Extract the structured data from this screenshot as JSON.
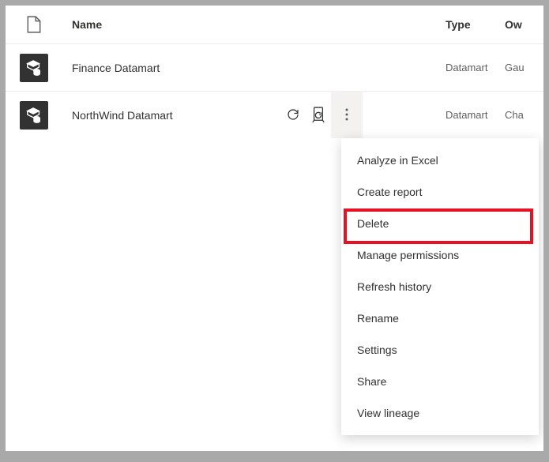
{
  "columns": {
    "name": "Name",
    "type": "Type",
    "owner": "Ow"
  },
  "rows": [
    {
      "name": "Finance Datamart",
      "type": "Datamart",
      "owner": "Gau"
    },
    {
      "name": "NorthWind Datamart",
      "type": "Datamart",
      "owner": "Cha"
    }
  ],
  "menu": {
    "analyze": "Analyze in Excel",
    "create": "Create report",
    "delete": "Delete",
    "permissions": "Manage permissions",
    "history": "Refresh history",
    "rename": "Rename",
    "settings": "Settings",
    "share": "Share",
    "lineage": "View lineage"
  }
}
